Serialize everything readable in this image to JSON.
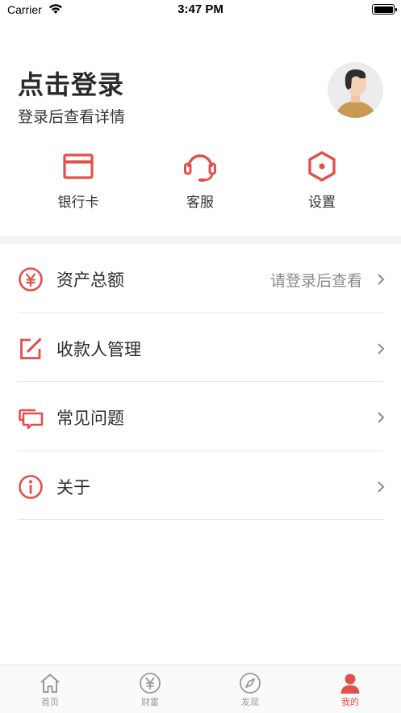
{
  "status_bar": {
    "carrier": "Carrier",
    "time": "3:47 PM"
  },
  "header": {
    "title": "点击登录",
    "subtitle": "登录后查看详情"
  },
  "shortcuts": [
    {
      "label": "银行卡",
      "icon": "bank-card-icon"
    },
    {
      "label": "客服",
      "icon": "headset-icon"
    },
    {
      "label": "设置",
      "icon": "hexagon-settings-icon"
    }
  ],
  "menu": [
    {
      "label": "资产总额",
      "value": "请登录后查看",
      "icon": "yuan-circle-icon"
    },
    {
      "label": "收款人管理",
      "value": "",
      "icon": "edit-icon"
    },
    {
      "label": "常见问题",
      "value": "",
      "icon": "chat-bubbles-icon"
    },
    {
      "label": "关于",
      "value": "",
      "icon": "info-icon"
    }
  ],
  "tabs": [
    {
      "label": "首页",
      "icon": "home-icon",
      "active": false
    },
    {
      "label": "财富",
      "icon": "yuan-icon",
      "active": false
    },
    {
      "label": "发现",
      "icon": "compass-icon",
      "active": false
    },
    {
      "label": "我的",
      "icon": "person-icon",
      "active": true
    }
  ],
  "colors": {
    "accent": "#e0514b",
    "tab_inactive": "#9a9a9a",
    "divider": "#f4f4f4"
  }
}
